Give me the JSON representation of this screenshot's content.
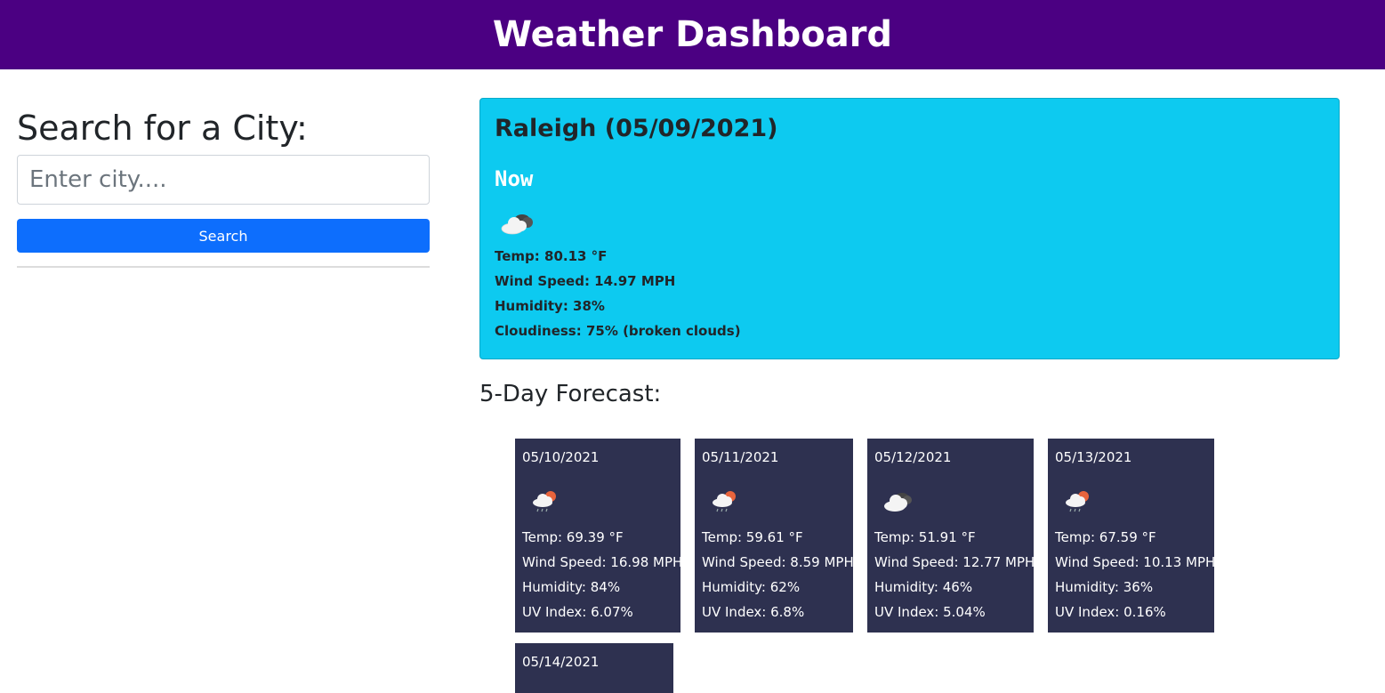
{
  "header": {
    "title": "Weather Dashboard"
  },
  "search": {
    "title": "Search for a City:",
    "placeholder": "Enter city....",
    "value": "",
    "button_label": "Search"
  },
  "current": {
    "city_date": "Raleigh (05/09/2021)",
    "now_label": "Now",
    "icon": "broken-clouds-icon",
    "temp": "Temp: 80.13 °F",
    "wind": "Wind Speed: 14.97 MPH",
    "humidity": "Humidity: 38%",
    "cloudiness": "Cloudiness: 75% (broken clouds)"
  },
  "forecast": {
    "heading": "5-Day Forecast:",
    "days": [
      {
        "date": "05/10/2021",
        "icon": "rain-sun-icon",
        "temp": "Temp: 69.39 °F",
        "wind": "Wind Speed: 16.98 MPH",
        "humidity": "Humidity: 84%",
        "uv": "UV Index: 6.07%"
      },
      {
        "date": "05/11/2021",
        "icon": "rain-sun-icon",
        "temp": "Temp: 59.61 °F",
        "wind": "Wind Speed: 8.59 MPH",
        "humidity": "Humidity: 62%",
        "uv": "UV Index: 6.8%"
      },
      {
        "date": "05/12/2021",
        "icon": "broken-clouds-icon",
        "temp": "Temp: 51.91 °F",
        "wind": "Wind Speed: 12.77 MPH",
        "humidity": "Humidity: 46%",
        "uv": "UV Index: 5.04%"
      },
      {
        "date": "05/13/2021",
        "icon": "rain-sun-icon",
        "temp": "Temp: 67.59 °F",
        "wind": "Wind Speed: 10.13 MPH",
        "humidity": "Humidity: 36%",
        "uv": "UV Index: 0.16%"
      },
      {
        "date": "05/14/2021"
      }
    ]
  },
  "colors": {
    "header_bg": "#4b0082",
    "search_button": "#0d6efd",
    "current_card_bg": "#0dcaf0",
    "forecast_card_bg": "#2e3150"
  }
}
